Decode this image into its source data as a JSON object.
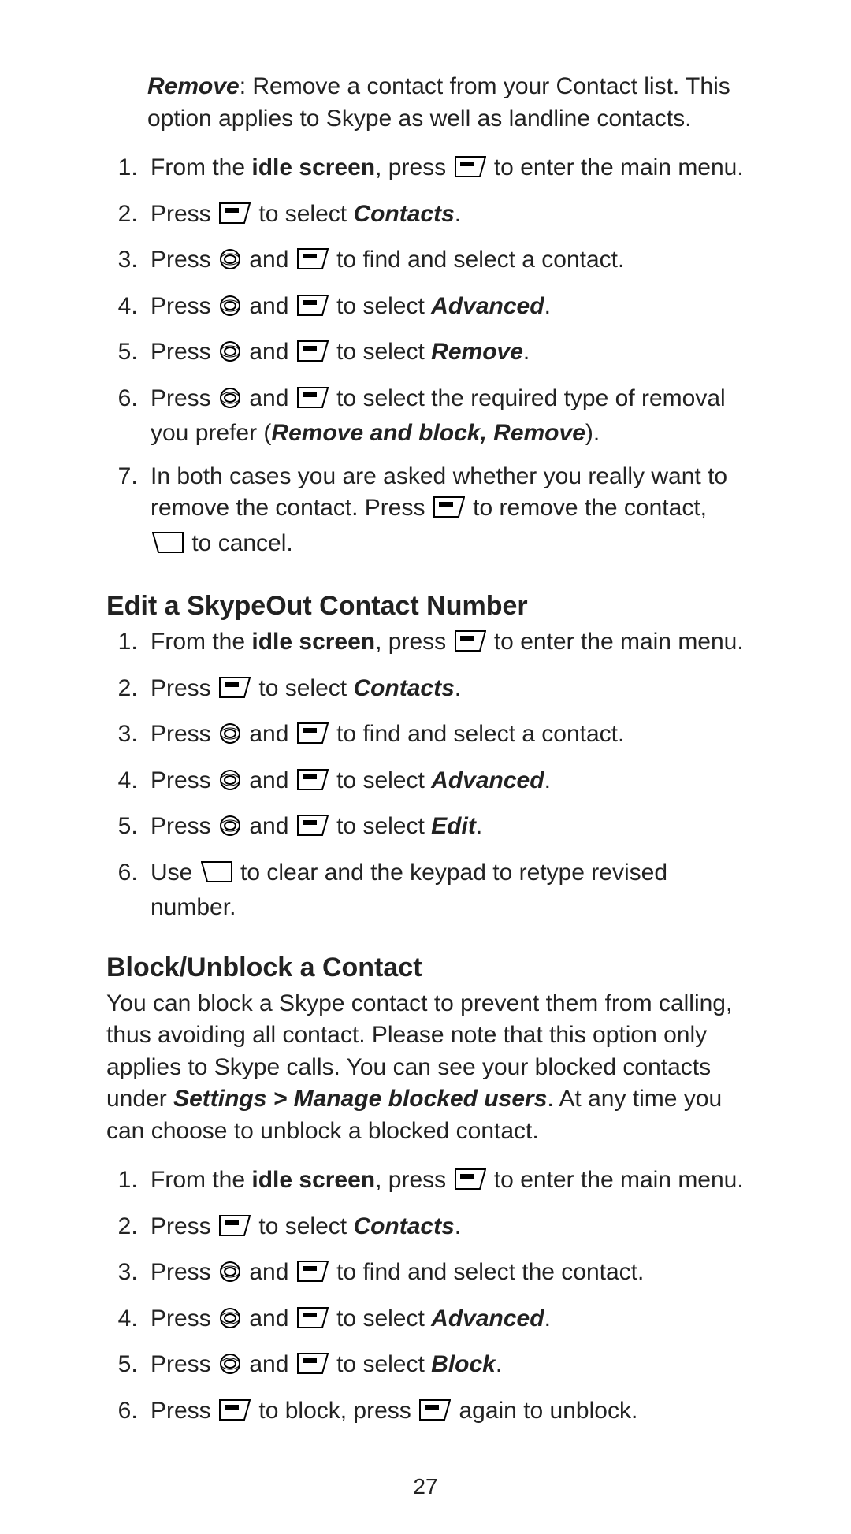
{
  "lead": {
    "remove_label": "Remove",
    "remove_desc": ":  Remove a contact from your Contact list. This option applies to Skype as well as landline contacts."
  },
  "secA": {
    "s1a": "From the ",
    "s1b": "idle screen",
    "s1c": ", press ",
    "s1d": " to enter the main menu.",
    "s2a": "Press ",
    "s2b": " to select ",
    "s2c": "Contacts",
    "s2d": ".",
    "s3a": "Press ",
    "s3b": " and ",
    "s3c": " to find and select a contact.",
    "s4a": "Press ",
    "s4b": " and ",
    "s4c": " to select ",
    "s4d": "Advanced",
    "s4e": ".",
    "s5a": "Press ",
    "s5b": " and ",
    "s5c": " to select ",
    "s5d": "Remove",
    "s5e": ".",
    "s6a": "Press ",
    "s6b": " and ",
    "s6c": " to select the required type of removal you prefer (",
    "s6d": "Remove and block, Remove",
    "s6e": ").",
    "s7a": "In both cases you are asked whether you really want to remove the contact. Press ",
    "s7b": " to remove the contact, ",
    "s7c": " to cancel."
  },
  "secB": {
    "heading": "Edit a SkypeOut Contact Number",
    "s1a": "From the ",
    "s1b": "idle screen",
    "s1c": ", press ",
    "s1d": " to enter the main menu.",
    "s2a": "Press ",
    "s2b": " to select ",
    "s2c": "Contacts",
    "s2d": ".",
    "s3a": "Press ",
    "s3b": " and ",
    "s3c": " to find and select a contact.",
    "s4a": "Press ",
    "s4b": " and ",
    "s4c": " to select ",
    "s4d": "Advanced",
    "s4e": ".",
    "s5a": "Press ",
    "s5b": " and ",
    "s5c": " to select ",
    "s5d": "Edit",
    "s5e": ".",
    "s6a": "Use ",
    "s6b": " to clear and the keypad to retype revised number."
  },
  "secC": {
    "heading": "Block/Unblock a Contact",
    "para_a": "You can block a Skype contact to prevent them from calling, thus avoiding all contact. Please note that this option only applies to Skype calls. You can see your blocked contacts under ",
    "para_b": "Settings > Manage blocked users",
    "para_c": ". At any time you can choose to unblock a blocked contact.",
    "s1a": "From the ",
    "s1b": "idle screen",
    "s1c": ", press ",
    "s1d": " to enter the main menu.",
    "s2a": "Press ",
    "s2b": " to select ",
    "s2c": "Contacts",
    "s2d": ".",
    "s3a": "Press ",
    "s3b": " and ",
    "s3c": " to find and select the contact.",
    "s4a": "Press ",
    "s4b": " and ",
    "s4c": " to select ",
    "s4d": "Advanced",
    "s4e": ".",
    "s5a": "Press ",
    "s5b": " and ",
    "s5c": " to select ",
    "s5d": "Block",
    "s5e": ".",
    "s6a": "Press ",
    "s6b": " to block, press ",
    "s6c": " again to unblock."
  },
  "page_number": "27"
}
